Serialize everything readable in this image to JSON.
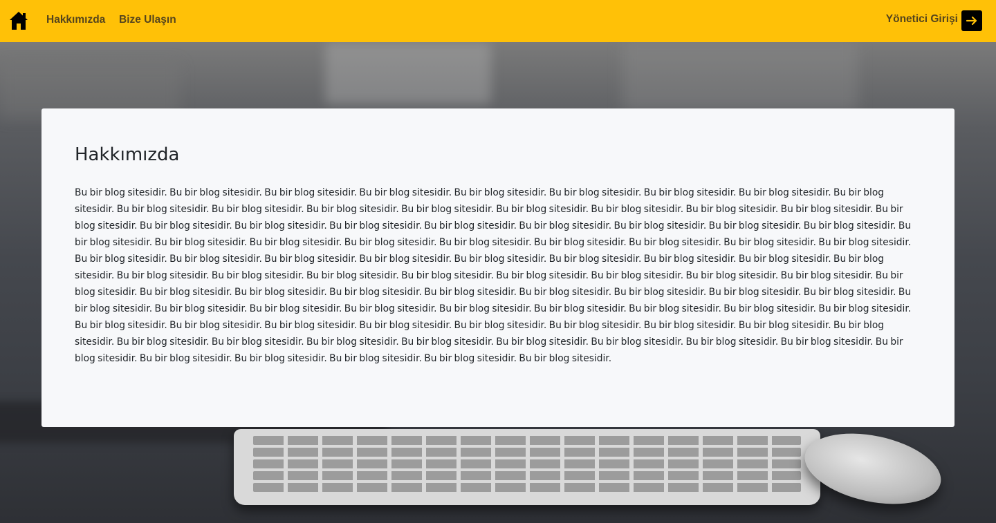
{
  "navbar": {
    "home_icon": "home-icon",
    "about_label": "Hakkımızda",
    "contact_label": "Bize Ulaşın",
    "admin_label": "Yönetici Girişi",
    "admin_icon": "arrow-right-icon",
    "background_color": "#ffc107"
  },
  "main": {
    "title": "Hakkımızda",
    "body": "Bu bir blog sitesidir. Bu bir blog sitesidir. Bu bir blog sitesidir. Bu bir blog sitesidir. Bu bir blog sitesidir. Bu bir blog sitesidir. Bu bir blog sitesidir. Bu bir blog sitesidir. Bu bir blog sitesidir. Bu bir blog sitesidir. Bu bir blog sitesidir. Bu bir blog sitesidir. Bu bir blog sitesidir. Bu bir blog sitesidir. Bu bir blog sitesidir. Bu bir blog sitesidir. Bu bir blog sitesidir. Bu bir blog sitesidir. Bu bir blog sitesidir. Bu bir blog sitesidir. Bu bir blog sitesidir. Bu bir blog sitesidir. Bu bir blog sitesidir. Bu bir blog sitesidir. Bu bir blog sitesidir. Bu bir blog sitesidir. Bu bir blog sitesidir. Bu bir blog sitesidir. Bu bir blog sitesidir. Bu bir blog sitesidir. Bu bir blog sitesidir. Bu bir blog sitesidir. Bu bir blog sitesidir. Bu bir blog sitesidir. Bu bir blog sitesidir. Bu bir blog sitesidir. Bu bir blog sitesidir. Bu bir blog sitesidir. Bu bir blog sitesidir. Bu bir blog sitesidir. Bu bir blog sitesidir. Bu bir blog sitesidir. Bu bir blog sitesidir. Bu bir blog sitesidir. Bu bir blog sitesidir. Bu bir blog sitesidir. Bu bir blog sitesidir. Bu bir blog sitesidir. Bu bir blog sitesidir. Bu bir blog sitesidir. Bu bir blog sitesidir. Bu bir blog sitesidir. Bu bir blog sitesidir. Bu bir blog sitesidir. Bu bir blog sitesidir. Bu bir blog sitesidir. Bu bir blog sitesidir. Bu bir blog sitesidir. Bu bir blog sitesidir. Bu bir blog sitesidir. Bu bir blog sitesidir. Bu bir blog sitesidir. Bu bir blog sitesidir. Bu bir blog sitesidir. Bu bir blog sitesidir. Bu bir blog sitesidir. Bu bir blog sitesidir. Bu bir blog sitesidir. Bu bir blog sitesidir. Bu bir blog sitesidir. Bu bir blog sitesidir. Bu bir blog sitesidir. Bu bir blog sitesidir. Bu bir blog sitesidir. Bu bir blog sitesidir. Bu bir blog sitesidir. Bu bir blog sitesidir. Bu bir blog sitesidir. Bu bir blog sitesidir. Bu bir blog sitesidir. Bu bir blog sitesidir. Bu bir blog sitesidir. Bu bir blog sitesidir. Bu bir blog sitesidir. Bu bir blog sitesidir. Bu bir blog sitesidir. Bu bir blog sitesidir. Bu bir blog sitesidir. Bu bir blog sitesidir. Bu bir blog sitesidir. Bu bir blog sitesidir. Bu bir blog sitesidir. Bu bir blog sitesidir."
  }
}
